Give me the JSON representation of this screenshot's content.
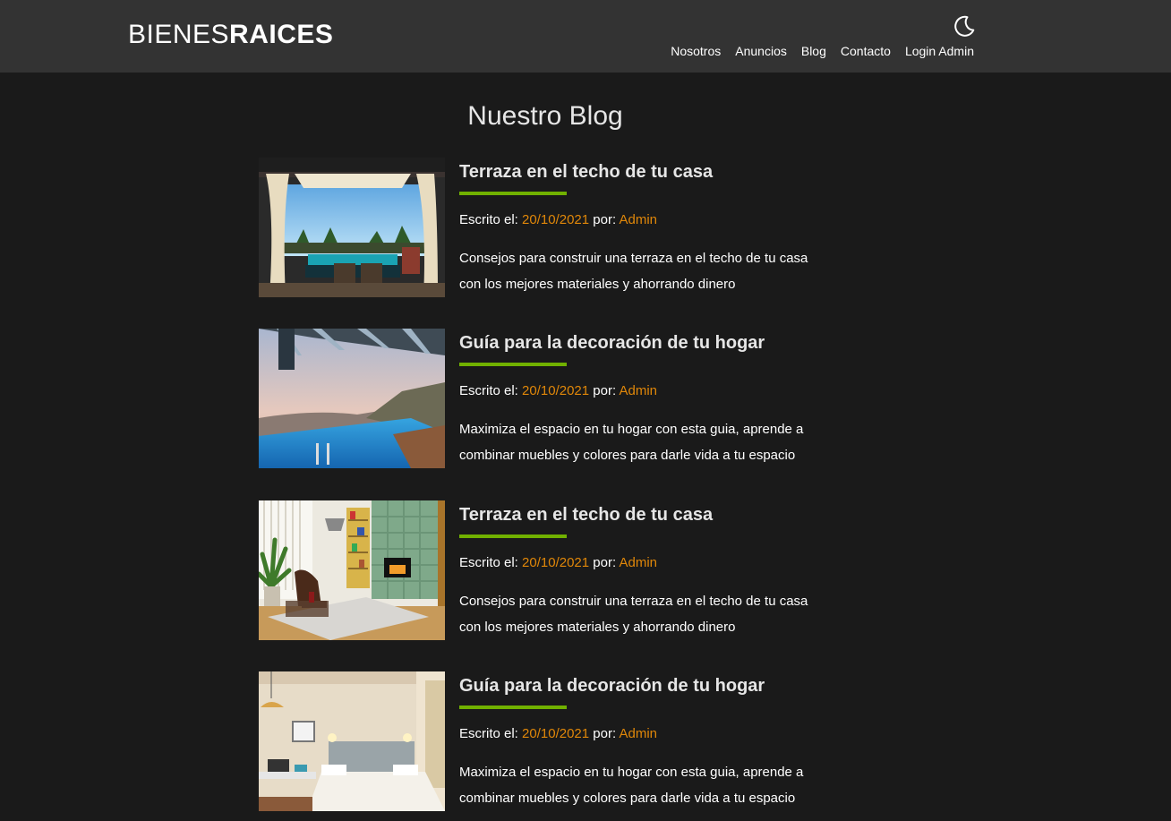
{
  "header": {
    "logo_light": "BIENES",
    "logo_bold": "RAICES",
    "nav": [
      "Nosotros",
      "Anuncios",
      "Blog",
      "Contacto",
      "Login Admin"
    ]
  },
  "page": {
    "title": "Nuestro Blog"
  },
  "posts": [
    {
      "title": "Terraza en el techo de tu casa",
      "written_label": "Escrito el:",
      "date": "20/10/2021",
      "by_label": "por:",
      "author": "Admin",
      "excerpt_line1": "Consejos para construir una terraza en el techo de tu casa",
      "excerpt_line2": "con los mejores materiales y ahorrando dinero"
    },
    {
      "title": "Guía para la decoración de tu hogar",
      "written_label": "Escrito el:",
      "date": "20/10/2021",
      "by_label": "por:",
      "author": "Admin",
      "excerpt_line1": "Maximiza el espacio en tu hogar con esta guia, aprende a",
      "excerpt_line2": "combinar muebles y colores para darle vida a tu espacio"
    },
    {
      "title": "Terraza en el techo de tu casa",
      "written_label": "Escrito el:",
      "date": "20/10/2021",
      "by_label": "por:",
      "author": "Admin",
      "excerpt_line1": "Consejos para construir una terraza en el techo de tu casa",
      "excerpt_line2": "con los mejores materiales y ahorrando dinero"
    },
    {
      "title": "Guía para la decoración de tu hogar",
      "written_label": "Escrito el:",
      "date": "20/10/2021",
      "by_label": "por:",
      "author": "Admin",
      "excerpt_line1": "Maximiza el espacio en tu hogar con esta guia, aprende a",
      "excerpt_line2": "combinar muebles y colores para darle vida a tu espacio"
    }
  ],
  "icons": {
    "theme_toggle": "moon-icon"
  },
  "colors": {
    "accent_green": "#71b100",
    "accent_orange": "#e08709",
    "header_bg": "#333333",
    "page_bg": "#1a1a1a"
  }
}
